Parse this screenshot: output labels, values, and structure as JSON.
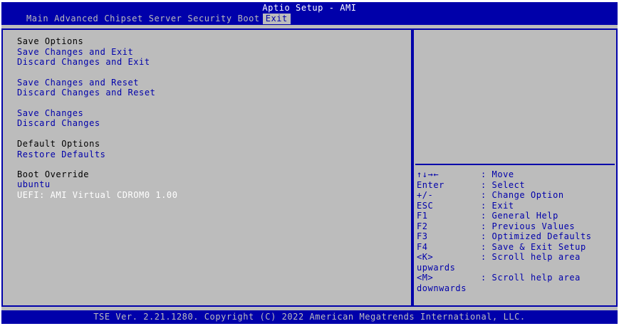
{
  "header": {
    "title": "Aptio Setup - AMI",
    "tabs": [
      "Main",
      "Advanced",
      "Chipset",
      "Server",
      "Security",
      "Boot",
      "Exit"
    ],
    "active_tab": "Exit"
  },
  "menu": {
    "save_options": {
      "heading": "Save Options",
      "save_exit": "Save Changes and Exit",
      "discard_exit": "Discard Changes and Exit",
      "save_reset": "Save Changes and Reset",
      "discard_reset": "Discard Changes and Reset",
      "save": "Save Changes",
      "discard": "Discard Changes"
    },
    "default_options": {
      "heading": "Default Options",
      "restore": "Restore Defaults"
    },
    "boot_override": {
      "heading": "Boot Override",
      "items": [
        "ubuntu",
        "UEFI: AMI Virtual CDROM0 1.00"
      ],
      "selected": "UEFI: AMI Virtual CDROM0 1.00"
    }
  },
  "help": {
    "text": "",
    "keys": [
      {
        "key": "↑↓→←",
        "desc": ": Move"
      },
      {
        "key": "Enter",
        "desc": ": Select"
      },
      {
        "key": "+/-",
        "desc": ": Change Option"
      },
      {
        "key": "ESC",
        "desc": ": Exit"
      },
      {
        "key": "F1",
        "desc": ": General Help"
      },
      {
        "key": "F2",
        "desc": ": Previous Values"
      },
      {
        "key": "F3",
        "desc": ": Optimized Defaults"
      },
      {
        "key": "F4",
        "desc": ": Save & Exit Setup"
      },
      {
        "key": "<K>",
        "desc": ": Scroll help area"
      },
      {
        "key": "upwards",
        "desc": ""
      },
      {
        "key": "<M>",
        "desc": ": Scroll help area"
      },
      {
        "key": "downwards",
        "desc": ""
      }
    ]
  },
  "footer": {
    "text": "TSE Ver. 2.21.1280. Copyright (C) 2022 American Megatrends International, LLC."
  },
  "colors": {
    "background": "#bcbcbc",
    "accent": "#0000aa",
    "selected_text": "#ffffff"
  }
}
